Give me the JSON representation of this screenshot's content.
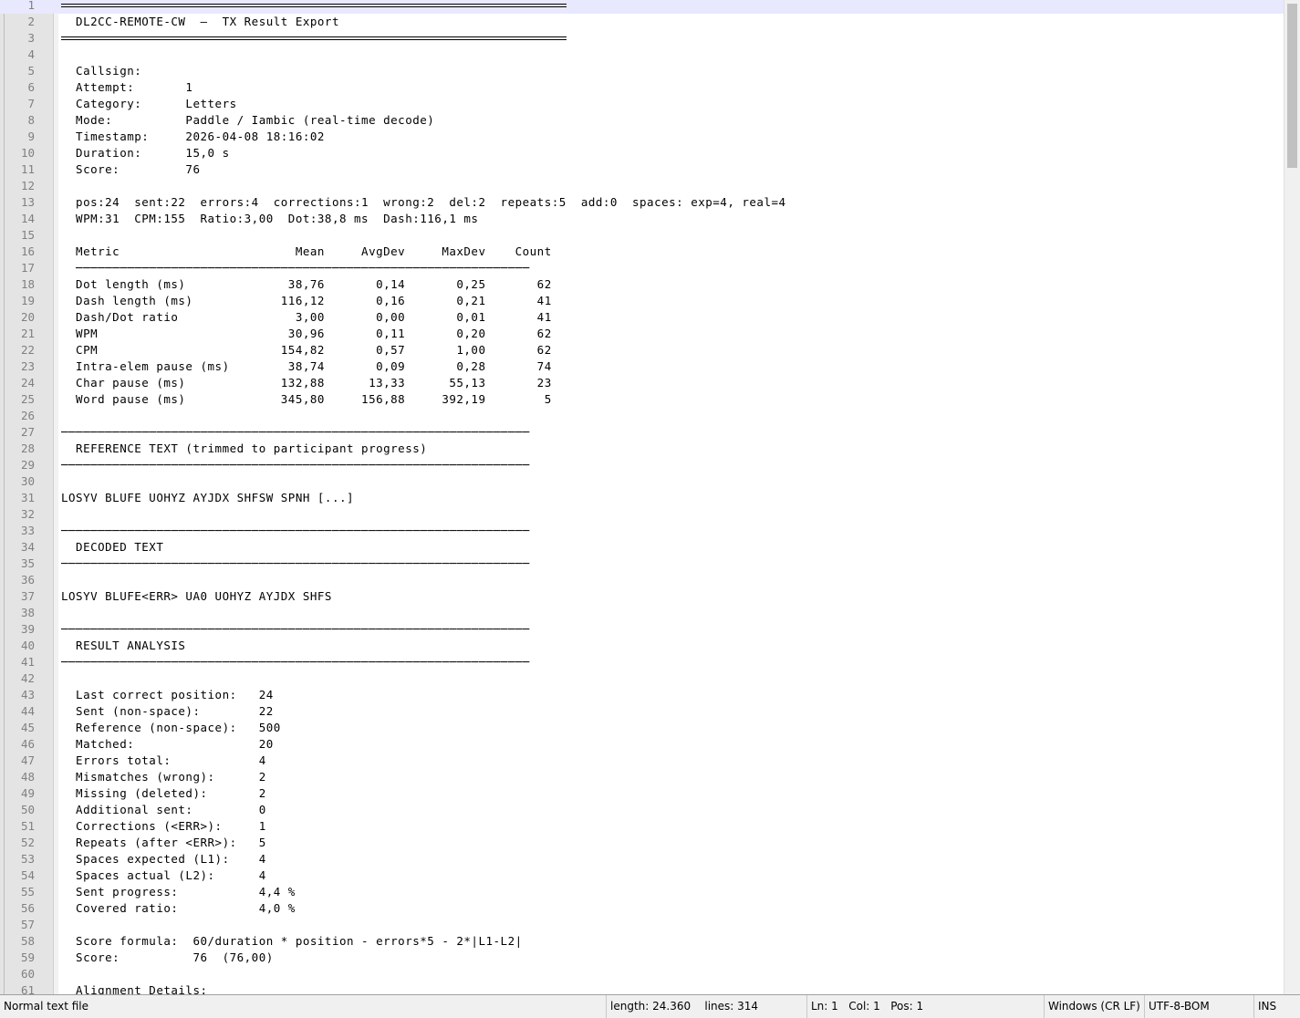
{
  "lines": [
    {
      "n": "1",
      "t": ""
    },
    {
      "n": "2",
      "t": "  DL2CC-REMOTE-CW  —  TX Result Export"
    },
    {
      "n": "3",
      "t": ""
    },
    {
      "n": "4",
      "t": ""
    },
    {
      "n": "5",
      "t": "  Callsign:"
    },
    {
      "n": "6",
      "t": "  Attempt:       1"
    },
    {
      "n": "7",
      "t": "  Category:      Letters"
    },
    {
      "n": "8",
      "t": "  Mode:          Paddle / Iambic (real-time decode)"
    },
    {
      "n": "9",
      "t": "  Timestamp:     2026-04-08 18:16:02"
    },
    {
      "n": "10",
      "t": "  Duration:      15,0 s"
    },
    {
      "n": "11",
      "t": "  Score:         76"
    },
    {
      "n": "12",
      "t": ""
    },
    {
      "n": "13",
      "t": "  pos:24  sent:22  errors:4  corrections:1  wrong:2  del:2  repeats:5  add:0  spaces: exp=4, real=4"
    },
    {
      "n": "14",
      "t": "  WPM:31  CPM:155  Ratio:3,00  Dot:38,8 ms  Dash:116,1 ms"
    },
    {
      "n": "15",
      "t": ""
    },
    {
      "n": "16",
      "t": "  Metric                        Mean     AvgDev     MaxDev    Count"
    },
    {
      "n": "17",
      "t": "  ──────────────────────────────────────────────────────────────"
    },
    {
      "n": "18",
      "t": "  Dot length (ms)              38,76       0,14       0,25       62"
    },
    {
      "n": "19",
      "t": "  Dash length (ms)            116,12       0,16       0,21       41"
    },
    {
      "n": "20",
      "t": "  Dash/Dot ratio                3,00       0,00       0,01       41"
    },
    {
      "n": "21",
      "t": "  WPM                          30,96       0,11       0,20       62"
    },
    {
      "n": "22",
      "t": "  CPM                         154,82       0,57       1,00       62"
    },
    {
      "n": "23",
      "t": "  Intra-elem pause (ms)        38,74       0,09       0,28       74"
    },
    {
      "n": "24",
      "t": "  Char pause (ms)             132,88      13,33      55,13       23"
    },
    {
      "n": "25",
      "t": "  Word pause (ms)             345,80     156,88     392,19        5"
    },
    {
      "n": "26",
      "t": ""
    },
    {
      "n": "27",
      "t": "────────────────────────────────────────────────────────────────"
    },
    {
      "n": "28",
      "t": "  REFERENCE TEXT (trimmed to participant progress)"
    },
    {
      "n": "29",
      "t": "────────────────────────────────────────────────────────────────"
    },
    {
      "n": "30",
      "t": ""
    },
    {
      "n": "31",
      "t": "LOSYV BLUFE UOHYZ AYJDX SHFSW SPNH [...]"
    },
    {
      "n": "32",
      "t": ""
    },
    {
      "n": "33",
      "t": "────────────────────────────────────────────────────────────────"
    },
    {
      "n": "34",
      "t": "  DECODED TEXT"
    },
    {
      "n": "35",
      "t": "────────────────────────────────────────────────────────────────"
    },
    {
      "n": "36",
      "t": ""
    },
    {
      "n": "37",
      "t": "LOSYV BLUFE<ERR> UA0 UOHYZ AYJDX SHFS"
    },
    {
      "n": "38",
      "t": ""
    },
    {
      "n": "39",
      "t": "────────────────────────────────────────────────────────────────"
    },
    {
      "n": "40",
      "t": "  RESULT ANALYSIS"
    },
    {
      "n": "41",
      "t": "────────────────────────────────────────────────────────────────"
    },
    {
      "n": "42",
      "t": ""
    },
    {
      "n": "43",
      "t": "  Last correct position:   24"
    },
    {
      "n": "44",
      "t": "  Sent (non-space):        22"
    },
    {
      "n": "45",
      "t": "  Reference (non-space):   500"
    },
    {
      "n": "46",
      "t": "  Matched:                 20"
    },
    {
      "n": "47",
      "t": "  Errors total:            4"
    },
    {
      "n": "48",
      "t": "  Mismatches (wrong):      2"
    },
    {
      "n": "49",
      "t": "  Missing (deleted):       2"
    },
    {
      "n": "50",
      "t": "  Additional sent:         0"
    },
    {
      "n": "51",
      "t": "  Corrections (<ERR>):     1"
    },
    {
      "n": "52",
      "t": "  Repeats (after <ERR>):   5"
    },
    {
      "n": "53",
      "t": "  Spaces expected (L1):    4"
    },
    {
      "n": "54",
      "t": "  Spaces actual (L2):      4"
    },
    {
      "n": "55",
      "t": "  Sent progress:           4,4 %"
    },
    {
      "n": "56",
      "t": "  Covered ratio:           4,0 %"
    },
    {
      "n": "57",
      "t": ""
    },
    {
      "n": "58",
      "t": "  Score formula:  60/duration * position - errors*5 - 2*|L1-L2|"
    },
    {
      "n": "59",
      "t": "  Score:          76  (76,00)"
    },
    {
      "n": "60",
      "t": ""
    },
    {
      "n": "61",
      "t": "  Alignment Details:"
    }
  ],
  "status": {
    "file_type": "Normal text file",
    "length": "length: 24.360",
    "lines": "lines: 314",
    "ln": "Ln: 1",
    "col": "Col: 1",
    "pos": "Pos: 1",
    "eol": "Windows (CR LF)",
    "encoding": "UTF-8-BOM",
    "mode": "INS"
  }
}
